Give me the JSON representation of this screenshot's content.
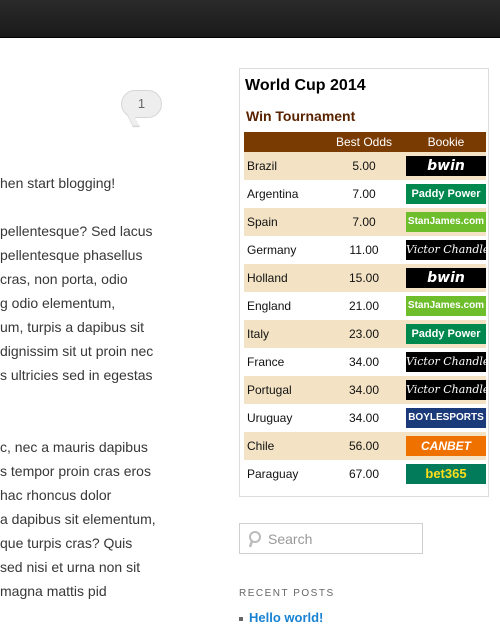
{
  "header": {
    "label": ""
  },
  "post": {
    "comment_count": "1",
    "lines": [
      "hen start blogging!",
      "pellentesque? Sed lacus",
      "pellentesque phasellus",
      "cras, non porta, odio",
      "g odio elementum,",
      "um, turpis a dapibus sit",
      "dignissim sit ut proin nec",
      "s ultricies sed in egestas",
      "c, nec a mauris dapibus",
      "s tempor proin cras eros",
      "hac rhoncus dolor",
      "a dapibus sit elementum,",
      "que turpis cras? Quis",
      "sed nisi et urna non sit",
      "magna mattis pid"
    ]
  },
  "widget": {
    "title": "World Cup 2014",
    "subtitle": "Win Tournament",
    "columns": [
      "",
      "Best Odds",
      "Bookie"
    ],
    "rows": [
      {
        "team": "Brazil",
        "odds": "5.00",
        "bookie": "bwin",
        "logo_class": "bwin"
      },
      {
        "team": "Argentina",
        "odds": "7.00",
        "bookie": "Paddy Power",
        "logo_class": "paddy"
      },
      {
        "team": "Spain",
        "odds": "7.00",
        "bookie": "StanJames.com",
        "logo_class": "stanjames"
      },
      {
        "team": "Germany",
        "odds": "11.00",
        "bookie": "Victor Chandler",
        "logo_class": "victor"
      },
      {
        "team": "Holland",
        "odds": "15.00",
        "bookie": "bwin",
        "logo_class": "bwin"
      },
      {
        "team": "England",
        "odds": "21.00",
        "bookie": "StanJames.com",
        "logo_class": "stanjames"
      },
      {
        "team": "Italy",
        "odds": "23.00",
        "bookie": "Paddy Power",
        "logo_class": "paddy"
      },
      {
        "team": "France",
        "odds": "34.00",
        "bookie": "Victor Chandler",
        "logo_class": "victor"
      },
      {
        "team": "Portugal",
        "odds": "34.00",
        "bookie": "Victor Chandler",
        "logo_class": "victor"
      },
      {
        "team": "Uruguay",
        "odds": "34.00",
        "bookie": "BOYLESPORTS",
        "logo_class": "boyle"
      },
      {
        "team": "Chile",
        "odds": "56.00",
        "bookie": "CANBET",
        "logo_class": "canbet"
      },
      {
        "team": "Paraguay",
        "odds": "67.00",
        "bookie": "bet365",
        "logo_class": "bet365"
      }
    ]
  },
  "search": {
    "placeholder": "Search"
  },
  "recent_posts": {
    "heading": "RECENT POSTS",
    "items": [
      "Hello world!"
    ]
  }
}
